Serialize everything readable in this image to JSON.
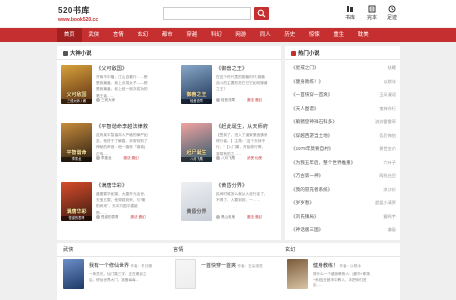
{
  "site": {
    "name": "520书库",
    "url": "www.book520.cc"
  },
  "search": {
    "placeholder": "",
    "value": ""
  },
  "tools": [
    {
      "label": "书库",
      "icon": "bookshelf-icon"
    },
    {
      "label": "完本",
      "icon": "completed-book-icon"
    },
    {
      "label": "足迹",
      "icon": "history-icon"
    }
  ],
  "nav": [
    "首页",
    "武侠",
    "言情",
    "玄幻",
    "都市",
    "穿越",
    "科幻",
    "网游",
    "同人",
    "历史",
    "惊悚",
    "重生",
    "耽美"
  ],
  "featured": {
    "title": "大神小说",
    "books": [
      {
        "name": "《父可敌国》",
        "desc": "开局不中槍，江山自看行……那是我篇章，我上贞观太子——那是我篇章，老上统一首次成功的第王者……",
        "author": "三戒大师",
        "cover_text": "父可敌国",
        "cover_author": "三戒大师 / 著",
        "colors": [
          "#5c2e14",
          "#d9a23a"
        ]
      },
      {
        "name": "《御兽之王》",
        "desc": "在这个时代里的御兽时代,御兽战斗的主要形态它已它如何御兽之王？",
        "author": "轻音流莺",
        "tag": "魔法·魔幻",
        "cover_text": "御兽之王",
        "cover_author": "轻音流莺",
        "colors": [
          "#1f3456",
          "#88a8c9"
        ]
      },
      {
        "name": "《平智谐命李越法律救恋草》",
        "desc": "这有某平智谐命人严格的律严如至，他终于了解路，非常特别了神秘的声音…他一旗帝「锦索]正传……",
        "author": "李墨龙",
        "tag": "魔法·魔幻",
        "cover_text": "平智谐命",
        "cover_author": "李墨龙",
        "colors": [
          "#2b1e12",
          "#c88c3c"
        ]
      },
      {
        "name": "《赶此诞生，从天师府开始》",
        "desc": "【签到了，进入了道家第追佛系修行者。】主角：“这个天师不行。”【入门阁，开始修行啊，准带有的之……",
        "author": "八月飞鹰",
        "tag": "武侠·仙侠",
        "cover_text": "赶尸诞生",
        "cover_author": "八月飞鹰",
        "colors": [
          "#2e5a6e",
          "#f2a3a0"
        ]
      },
      {
        "name": "《满唐华彩》",
        "desc": "盛唐繁华如锦，大唐开元治世，天宝五载，他穿越到来，与“暖阳间来”，天冲万国平建欧物……",
        "author": "怪诞的表哥",
        "tag": "魔法·魔幻",
        "cover_text": "满唐华彩",
        "cover_author": "怪诞的表哥",
        "colors": [
          "#3a1a10",
          "#d84c2c"
        ]
      },
      {
        "name": "《黄昏分界》",
        "desc": "民间时候怎么就从人说行走了，不得了，人要到到，一……",
        "author": "黑山老鬼",
        "tag": "魔法·魔幻",
        "cover_text": "黄昏分界",
        "cover_author": "",
        "colors": [
          "#c6ccd6",
          "#eef0f3"
        ]
      }
    ]
  },
  "hot": {
    "title": "热门小说",
    "items": [
      {
        "name": "《星戒之门》",
        "author": "扶曦"
      },
      {
        "name": "《健身教练！》",
        "author": "以棋冰"
      },
      {
        "name": "《一首快穿一首爽》",
        "author": "玉朵漫语"
      },
      {
        "name": "《天人图谱》",
        "author": "鬼神亦行"
      },
      {
        "name": "《躺猪登神祥石科多》",
        "author": "流苏雷雷亭"
      },
      {
        "name": "《穿越西游当土地》",
        "author": "吾后悔怕"
      },
      {
        "name": "《1979年莫要自村》",
        "author": "黄世金爪"
      },
      {
        "name": "《为我五年后，整个世界推重》",
        "author": "六叶子"
      },
      {
        "name": "《万古第一神》",
        "author": "两纸白目"
      },
      {
        "name": "《我的冒充者系统》",
        "author": "凉沙衫"
      },
      {
        "name": "《岁岁春》",
        "author": "超爱小清界"
      },
      {
        "name": "《刘氏镇局》",
        "author": "霸鸣芋"
      },
      {
        "name": "《神话版三国》",
        "author": "谦辰"
      }
    ]
  },
  "sections": [
    {
      "title": "武侠",
      "book": {
        "name": "我有一个修仙世界",
        "tag": "作者：冬日暖",
        "desc": "一条灵光，仙门路三字，正在悬谈之后，修仙世界大门，准备每每…",
        "colors": [
          "#1d3a66",
          "#6d8ec9"
        ]
      }
    },
    {
      "title": "言情",
      "book": {
        "name": "一首快穿一首爽",
        "tag": "作者：玉朵漫语",
        "desc": "",
        "colors": [
          "#eeeeee",
          "#f6f6f6"
        ]
      }
    },
    {
      "title": "玄幻",
      "book": {
        "name": "健身教练！",
        "tag": "作者：以棋冰",
        "desc": "穿什么一个键身教练人：[都市+职场+系统]在都市中教人，手把你们进出……",
        "colors": [
          "#d9c6a6",
          "#7a5a3a"
        ]
      }
    }
  ],
  "colors": {
    "brand": "#c62f2f",
    "nav_active": "#a32020"
  }
}
